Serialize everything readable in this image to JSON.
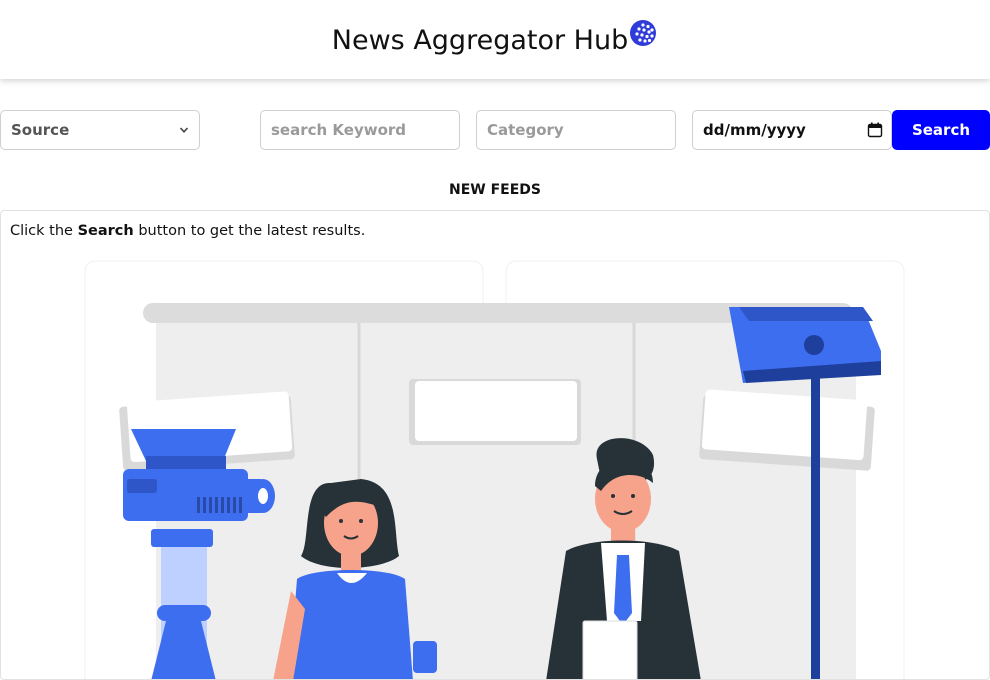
{
  "header": {
    "title": "News Aggregator Hub",
    "logo_icon": "globe-icon"
  },
  "filters": {
    "source": {
      "selected": "Source"
    },
    "keyword": {
      "placeholder": "search Keyword"
    },
    "category": {
      "placeholder": "Category"
    },
    "date": {
      "value": "dd/mm/yyyy",
      "icon": "calendar-icon"
    },
    "search_label": "Search"
  },
  "feeds": {
    "title": "NEW FEEDS",
    "hint_before": "Click the ",
    "hint_bold": "Search",
    "hint_after": " button to get the latest results."
  },
  "colors": {
    "accent": "#0000ff",
    "illustration_blue": "#3d6ef0",
    "illustration_dark": "#263238"
  }
}
